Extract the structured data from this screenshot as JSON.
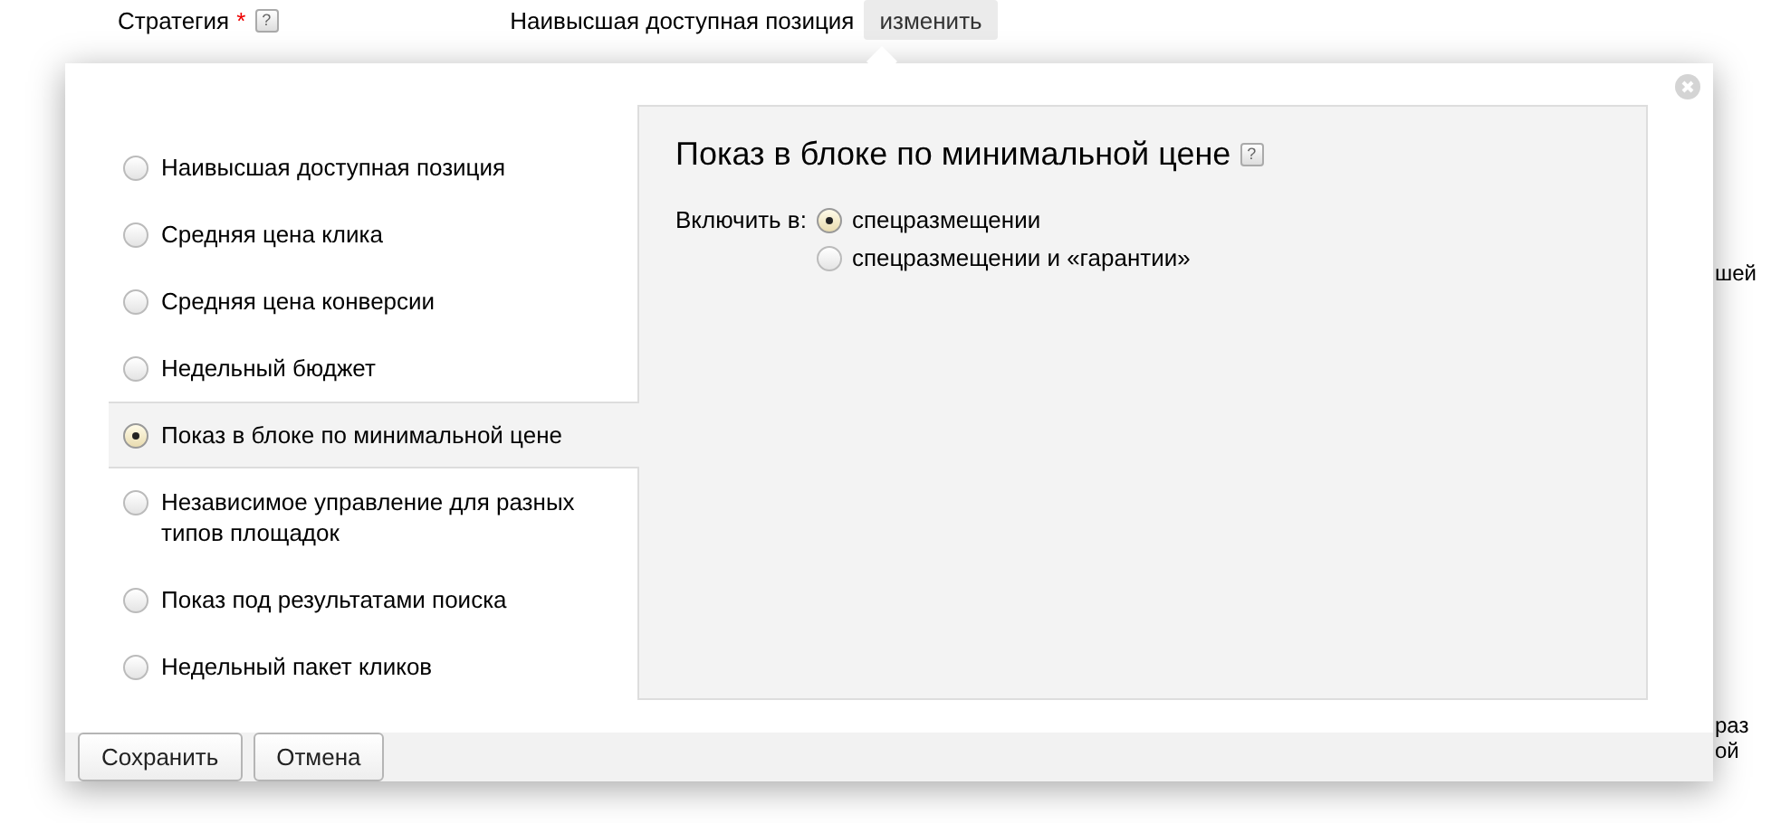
{
  "page": {
    "field_label": "Стратегия",
    "required_mark": "*",
    "help": "?",
    "value": "Наивысшая доступная позиция",
    "change_button": "изменить",
    "background_fragments": [
      "шей",
      "раз",
      "ой"
    ]
  },
  "dialog": {
    "strategies": [
      {
        "label": "Наивысшая доступная позиция",
        "selected": false
      },
      {
        "label": "Средняя цена клика",
        "selected": false
      },
      {
        "label": "Средняя цена конверсии",
        "selected": false
      },
      {
        "label": "Недельный бюджет",
        "selected": false
      },
      {
        "label": "Показ в блоке по минимальной цене",
        "selected": true
      },
      {
        "label": "Независимое управление для разных типов площадок",
        "selected": false
      },
      {
        "label": "Показ под результатами поиска",
        "selected": false
      },
      {
        "label": "Недельный пакет кликов",
        "selected": false
      }
    ],
    "panel": {
      "title": "Показ в блоке по минимальной цене",
      "help": "?",
      "include_label": "Включить в:",
      "options": [
        {
          "label": "спецразмещении",
          "selected": true
        },
        {
          "label": "спецразмещении и «гарантии»",
          "selected": false
        }
      ]
    },
    "buttons": [
      "Сохранить",
      "Отмена"
    ]
  }
}
